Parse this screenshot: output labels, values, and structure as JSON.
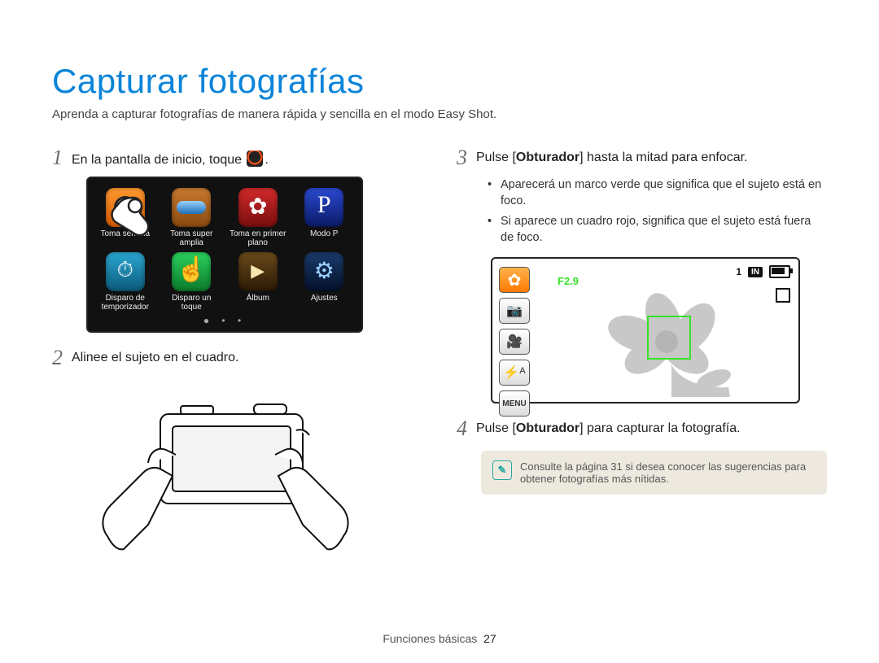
{
  "title": "Capturar fotografías",
  "subtitle": "Aprenda a capturar fotografías de manera rápida y sencilla en el modo Easy Shot.",
  "steps": {
    "s1_pre": "En la pantalla de inicio, toque ",
    "s1_post": ".",
    "s2": "Alinee el sujeto en el cuadro.",
    "s3_pre": "Pulse [",
    "s3_bold": "Obturador",
    "s3_post": "] hasta la mitad para enfocar.",
    "s4_pre": "Pulse [",
    "s4_bold": "Obturador",
    "s4_post": "] para capturar la fotografía."
  },
  "step_numbers": {
    "n1": "1",
    "n2": "2",
    "n3": "3",
    "n4": "4"
  },
  "home_apps": [
    {
      "label": "Toma sencilla",
      "cls": "ic-orange"
    },
    {
      "label": "Toma super amplia",
      "cls": "ic-wide"
    },
    {
      "label": "Toma en primer plano",
      "cls": "ic-macro"
    },
    {
      "label": "Modo P",
      "cls": "ic-p"
    },
    {
      "label": "Disparo de temporizador",
      "cls": "ic-timer"
    },
    {
      "label": "Disparo un toque",
      "cls": "ic-touch"
    },
    {
      "label": "Álbum",
      "cls": "ic-album"
    },
    {
      "label": "Ajustes",
      "cls": "ic-settings"
    }
  ],
  "page_dots": "●  •  •",
  "bullets": [
    "Aparecerá un marco verde que significa que el sujeto está en foco.",
    "Si aparece un cuadro rojo, significa que el sujeto está fuera de foco."
  ],
  "screen2": {
    "f_value": "F2.9",
    "shots": "1",
    "in_label": "IN",
    "side": {
      "macro": "✿",
      "photo": "📷",
      "video": "🎥",
      "flash": "⚡ᴬ",
      "menu": "MENU"
    }
  },
  "note": "Consulte la página 31 si desea conocer las sugerencias para obtener fotografías más nítidas.",
  "footer_section": "Funciones básicas",
  "footer_page": "27"
}
